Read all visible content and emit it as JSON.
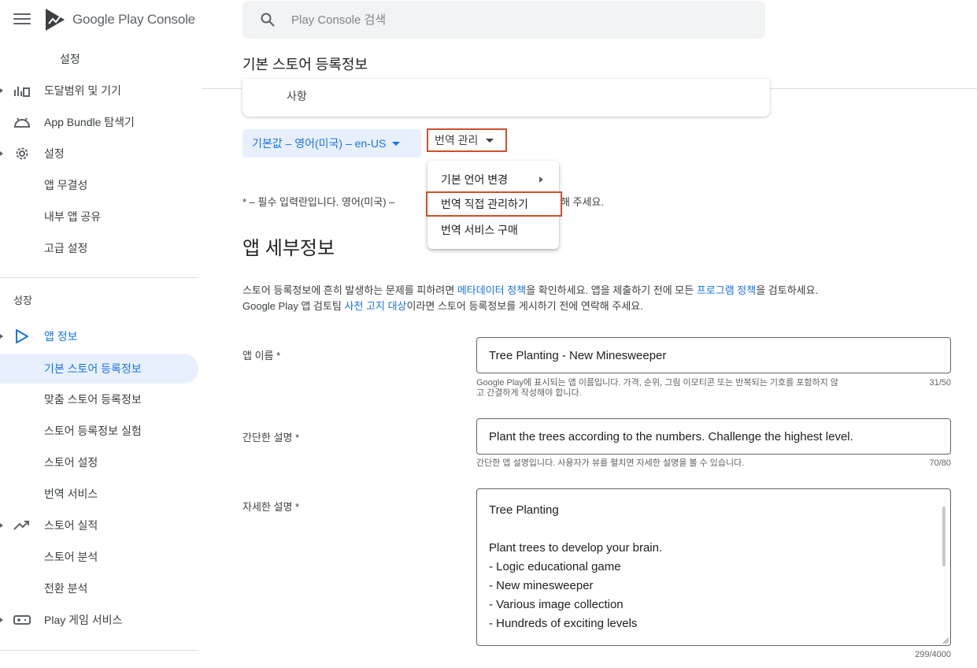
{
  "app": {
    "logo_text": "Google Play Console"
  },
  "search": {
    "placeholder": "Play Console 검색"
  },
  "page": {
    "title": "기본 스토어 등록정보"
  },
  "sidebar": {
    "settings_top": "설정",
    "reach": "도달범위 및 기기",
    "bundle": "App Bundle 탐색기",
    "settings": "설정",
    "integrity": "앱 무결성",
    "internal_share": "내부 앱 공유",
    "advanced": "고급 설정",
    "growth_section": "성장",
    "app_info": "앱 정보",
    "main_listing": "기본 스토어 등록정보",
    "custom_listing": "맞춤 스토어 등록정보",
    "listing_experiments": "스토어 등록정보 실험",
    "store_settings": "스토어 설정",
    "translation": "번역 서비스",
    "store_performance": "스토어 실적",
    "store_analysis": "스토어 분석",
    "conversion_analysis": "전환 분석",
    "play_games": "Play 게임 서비스"
  },
  "prev_card": {
    "text": "사항"
  },
  "language": {
    "default_label": "기본값 – 영어(미국) – en-US",
    "manage_label": "번역 관리"
  },
  "menu": {
    "change_default": "기본 언어 변경",
    "manage_directly": "번역 직접 관리하기",
    "buy_translation": "번역 서비스 구매"
  },
  "notes": {
    "required_prefix": "* – 필수 입력란입니다. 영어(미국) –",
    "required_suffix": "해 주세요."
  },
  "details": {
    "title": "앱 세부정보",
    "desc1_a": "스토어 등록정보에 흔히 발생하는 문제를 피하려면 ",
    "desc1_link1": "메타데이터 정책",
    "desc1_b": "을 확인하세요. 앱을 제출하기 전에 모든 ",
    "desc1_link2": "프로그램 정책",
    "desc1_c": "을 검토하세요.",
    "desc2_a": "Google Play 앱 검토팀 ",
    "desc2_link": "사전 고지 대상",
    "desc2_b": "이라면 스토어 등록정보를 게시하기 전에 연락해 주세요."
  },
  "fields": {
    "app_name": {
      "label": "앱 이름 *",
      "value": "Tree Planting - New Minesweeper",
      "helper1": "Google Play에 표시되는 앱 이름입니다. 가격, 순위, 그림 이모티콘 또는 반복되는 기호를 포함하지 않",
      "helper2": "고 간결하게 작성해야 합니다.",
      "counter": "31/50"
    },
    "short_desc": {
      "label": "간단한 설명 *",
      "value": "Plant the trees according to the numbers. Challenge the highest level.",
      "helper": "간단한 앱 설명입니다. 사용자가 뷰를 펼치면 자세한 설명을 볼 수 있습니다.",
      "counter": "70/80"
    },
    "full_desc": {
      "label": "자세한 설명 *",
      "lines": [
        "Tree Planting",
        "",
        "Plant trees to develop your brain.",
        "- Logic educational game",
        "- New minesweeper",
        "- Various image collection",
        "- Hundreds of exciting levels"
      ],
      "counter": "299/4000"
    }
  },
  "colors": {
    "accent": "#1a73e8",
    "highlight_border": "#d0502b"
  }
}
